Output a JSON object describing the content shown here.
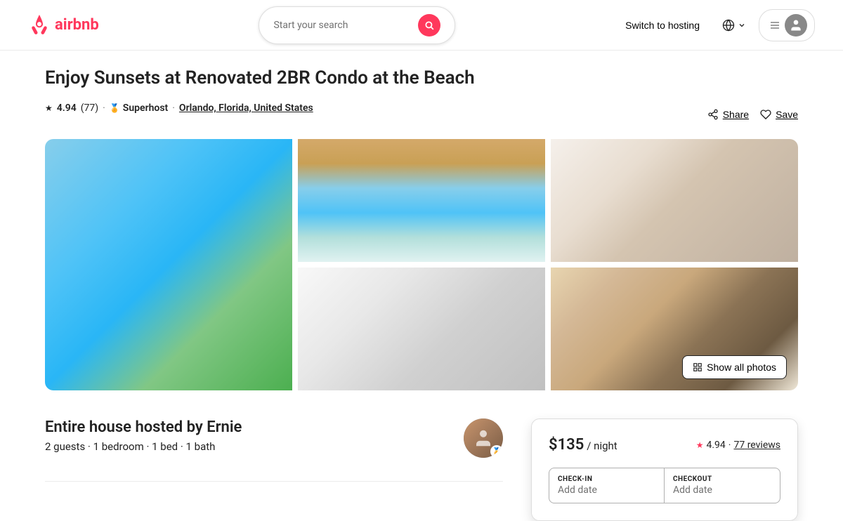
{
  "nav": {
    "logo_text": "airbnb",
    "search_placeholder": "Start your search",
    "hosting_label": "Switch to hosting",
    "menu_aria": "Menu",
    "globe_aria": "Choose language"
  },
  "listing": {
    "title": "Enjoy Sunsets at Renovated 2BR Condo at the Beach",
    "rating": "4.94",
    "review_count": "77",
    "superhost_label": "Superhost",
    "location": "Orlando, Florida, United States",
    "share_label": "Share",
    "save_label": "Save",
    "photos": {
      "show_all_label": "Show all photos"
    }
  },
  "host": {
    "title": "Entire house hosted by Ernie",
    "guests": "2 guests",
    "bedrooms": "1 bedroom",
    "beds": "1 bed",
    "baths": "1 bath"
  },
  "booking": {
    "price": "$135",
    "per_night": "/ night",
    "rating": "4.94",
    "review_count": "77",
    "checkin_label": "CHECK-IN",
    "checkout_label": "CHECKOUT",
    "checkin_placeholder": "Add date",
    "checkout_placeholder": "Add date"
  }
}
